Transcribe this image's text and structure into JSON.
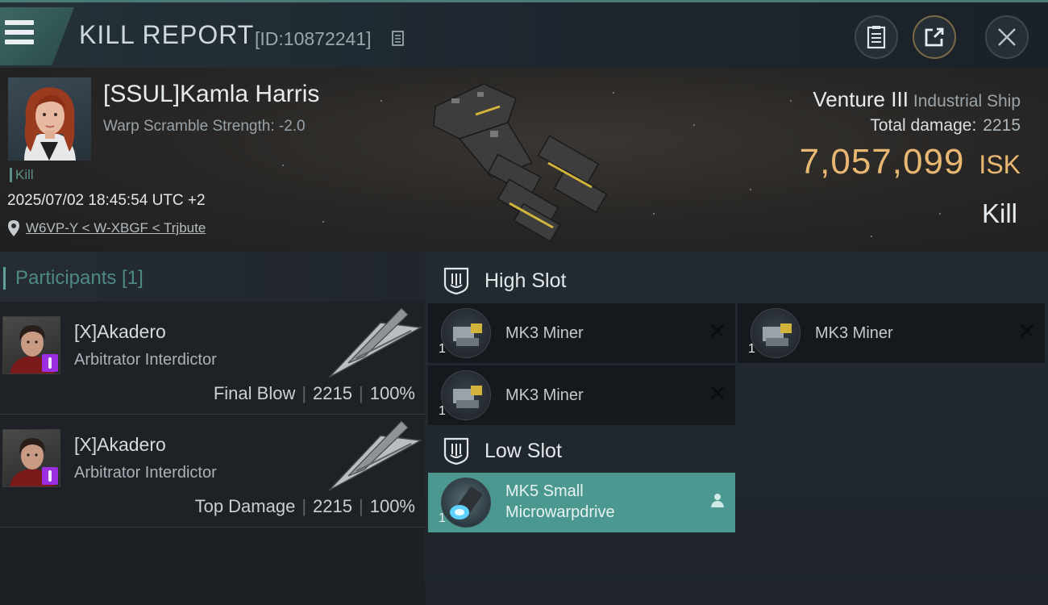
{
  "header": {
    "title": "KILL REPORT",
    "report_id": "[ID:10872241]"
  },
  "victim": {
    "name": "[SSUL]Kamla Harris",
    "warp_scramble": "Warp Scramble Strength: -2.0",
    "kill_tag": "Kill",
    "datetime": "2025/07/02 18:45:54 UTC +2",
    "location": "W6VP-Y < W-XBGF < Trjbute",
    "ship_name": "Venture III",
    "ship_class": "Industrial Ship",
    "total_damage_label": "Total damage:",
    "total_damage": "2215",
    "isk_value": "7,057,099",
    "isk_unit": "ISK",
    "result": "Kill"
  },
  "participants": {
    "title": "Participants [1]",
    "rows": [
      {
        "name": "[X]Akadero",
        "ship": "Arbitrator Interdictor",
        "role": "Final Blow",
        "damage": "2215",
        "percent": "100%"
      },
      {
        "name": "[X]Akadero",
        "ship": "Arbitrator Interdictor",
        "role": "Top Damage",
        "damage": "2215",
        "percent": "100%"
      }
    ]
  },
  "fittings": {
    "high_slot_label": "High Slot",
    "low_slot_label": "Low Slot",
    "high": [
      {
        "name": "MK3 Miner",
        "qty": "1",
        "state": "destroyed"
      },
      {
        "name": "MK3 Miner",
        "qty": "1",
        "state": "destroyed"
      },
      {
        "name": "MK3 Miner",
        "qty": "1",
        "state": "destroyed"
      }
    ],
    "low": [
      {
        "name_line1": "MK5 Small",
        "name_line2": "Microwarpdrive",
        "qty": "1",
        "state": "dropped"
      }
    ]
  },
  "colors": {
    "accent_teal": "#4a9890",
    "isk_gold": "#e8b873",
    "badge_purple": "#9b2ee0"
  },
  "icons": {
    "menu": "hamburger-icon",
    "copy": "copy-icon",
    "report": "document-icon",
    "share": "share-icon",
    "close": "close-icon",
    "location": "map-pin-icon",
    "slot": "shield-slot-icon",
    "destroyed": "x-mark-icon",
    "dropped": "person-icon"
  }
}
